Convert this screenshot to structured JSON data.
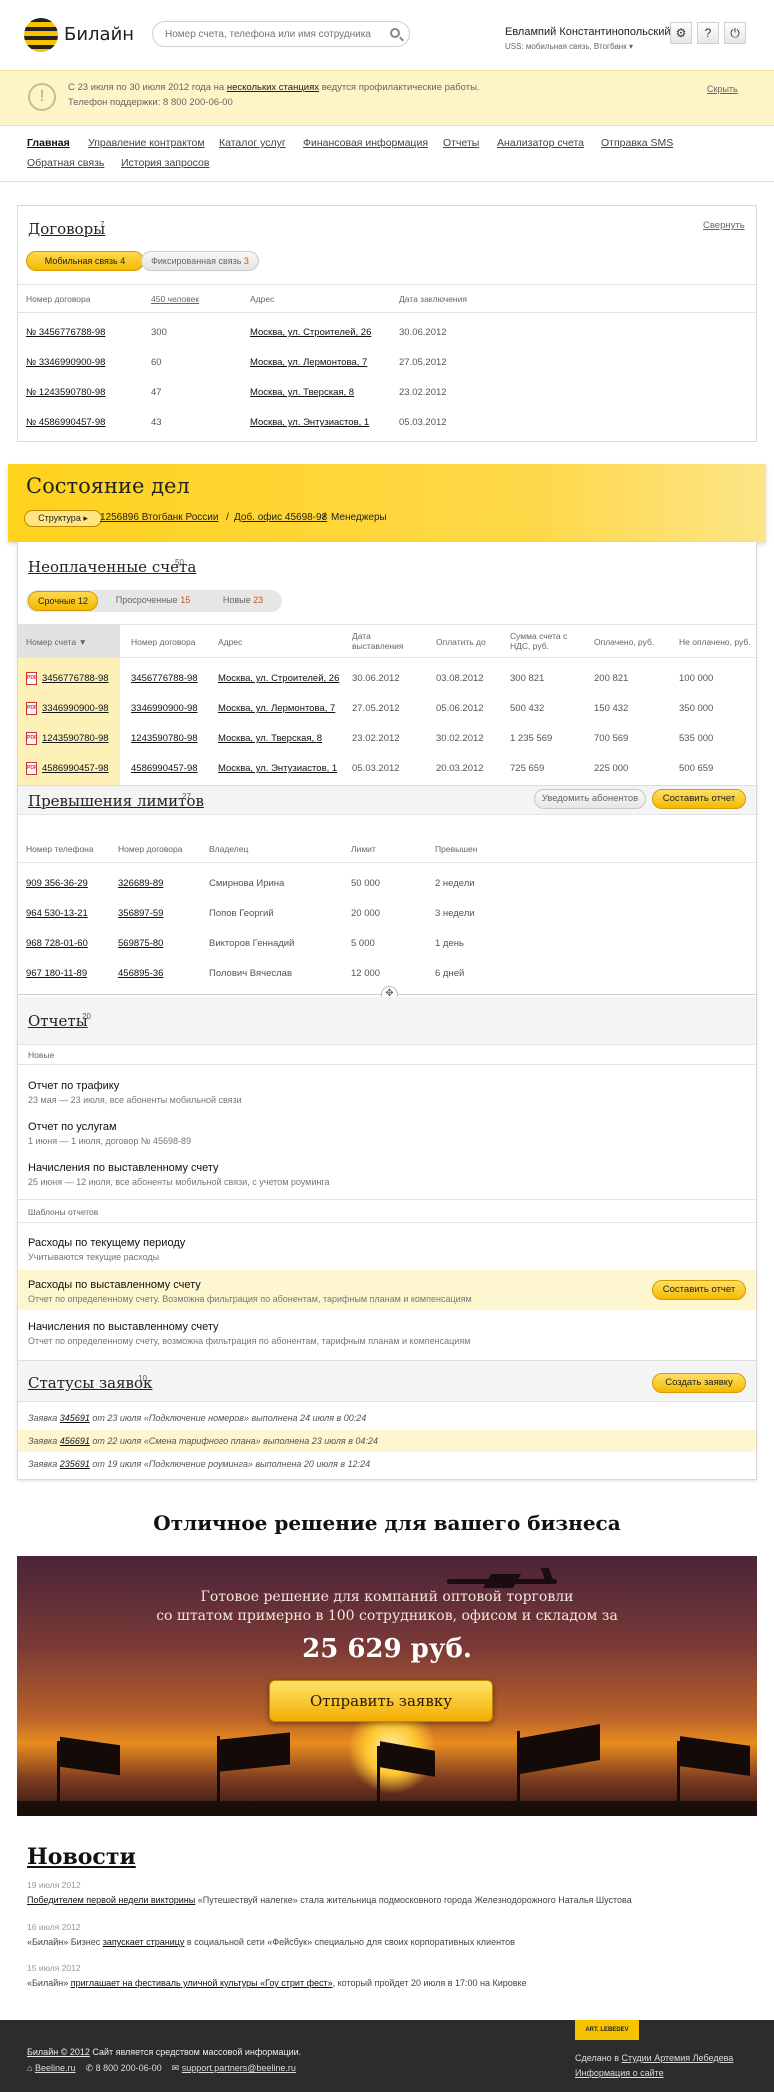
{
  "header": {
    "logo_text": "Билайн",
    "search_placeholder": "Номер счета, телефона или имя сотрудника",
    "user_name": "Евлампий Константинопольский",
    "user_sub": "USS: мобильная связь, Втогбанк",
    "btn_settings": "⚙",
    "btn_help": "?",
    "btn_exit": "⏻"
  },
  "notice": {
    "icon": "!",
    "text_pre": "С 23 июля по 30 июля 2012 года на ",
    "link": "нескольких станциях",
    "text_post": " ведутся профилактические работы.",
    "phone": "Телефон поддержки: 8 800 200-06-00",
    "hide": "Скрыть"
  },
  "nav": [
    "Главная",
    "Управление контрактом",
    "Каталог услуг",
    "Финансовая информация",
    "Отчеты",
    "Анализатор счета",
    "Отправка SMS",
    "Обратная связь",
    "История запросов"
  ],
  "contracts": {
    "title": "Договоры",
    "count": "7",
    "collapse": "Свернуть",
    "tab1": "Мобильная связь",
    "tab1_n": "4",
    "tab2": "Фиксированная связь",
    "tab2_n": "3",
    "headers": [
      "Номер договора",
      "450 человек",
      "Адрес",
      "Дата заключения"
    ],
    "rows": [
      [
        "№ 3456776788-98",
        "300",
        "Москва, ул. Строителей, 26",
        "30.06.2012"
      ],
      [
        "№ 3346990900-98",
        "60",
        "Москва, ул. Лермонтова, 7",
        "27.05.2012"
      ],
      [
        "№ 1243590780-98",
        "47",
        "Москва, ул. Тверская, 8",
        "23.02.2012"
      ],
      [
        "№ 4586990457-98",
        "43",
        "Москва, ул. Энтузиастов, 1",
        "05.03.2012"
      ]
    ]
  },
  "state": {
    "title": "Состояние дел",
    "crumb_btn": "Структура",
    "crumb_1": "1256896 Втогбанк России",
    "crumb_2": "Доб. офис 45698-98",
    "crumb_3": "Менеджеры",
    "sep": "/"
  },
  "unpaid": {
    "title": "Неоплаченные счета",
    "count": "50",
    "tab1": "Срочные",
    "tab1_n": "12",
    "tab2": "Просроченные",
    "tab2_n": "15",
    "tab3": "Новые",
    "tab3_n": "23",
    "headers": [
      "Номер счета",
      "Номер договора",
      "Адрес",
      "Дата выставления",
      "Оплатить до",
      "Сумма счета с НДС, руб.",
      "Оплачено, руб.",
      "Не оплачено, руб."
    ],
    "rows": [
      [
        "3456776788-98",
        "3456776788-98",
        "Москва, ул. Строителей, 26",
        "30.06.2012",
        "03.08.2012",
        "300 821",
        "200 821",
        "100 000"
      ],
      [
        "3346990900-98",
        "3346990900-98",
        "Москва, ул. Лермонтова, 7",
        "27.05.2012",
        "05.06.2012",
        "500 432",
        "150 432",
        "350 000"
      ],
      [
        "1243590780-98",
        "1243590780-98",
        "Москва, ул. Тверская, 8",
        "23.02.2012",
        "30.02.2012",
        "1 235 569",
        "700 569",
        "535 000"
      ],
      [
        "4586990457-98",
        "4586990457-98",
        "Москва, ул. Энтузиастов, 1",
        "05.03.2012",
        "20.03.2012",
        "725 659",
        "225 000",
        "500 659"
      ]
    ],
    "pdf": "PDF"
  },
  "limits": {
    "title": "Превышения лимитов",
    "count": "27",
    "btn_notify": "Уведомить абонентов",
    "btn_report": "Составить отчет",
    "headers": [
      "Номер телефона",
      "Номер договора",
      "Владелец",
      "Лимит",
      "Превышен"
    ],
    "rows": [
      [
        "909 356-36-29",
        "326689-89",
        "Смирнова Ирина",
        "50 000",
        "2 недели"
      ],
      [
        "964 530-13-21",
        "356897-59",
        "Попов Георгий",
        "20 000",
        "3 недели"
      ],
      [
        "968 728-01-60",
        "569875-80",
        "Викторов Геннадий",
        "5 000",
        "1 день"
      ],
      [
        "967 180-11-89",
        "456895-36",
        "Полович Вячеслав",
        "12 000",
        "6 дней"
      ]
    ]
  },
  "reports": {
    "title": "Отчеты",
    "count": "20",
    "new_label": "Новые",
    "new_items": [
      [
        "Отчет по трафику",
        "23 мая — 23 июля, все абоненты мобильной связи"
      ],
      [
        "Отчет по услугам",
        "1 июня — 1 июля, договор № 45698-89"
      ],
      [
        "Начисления по выставленному счету",
        "25 июня — 12 июля, все абоненты мобильной связи, с учетом роуминга"
      ]
    ],
    "tpl_label": "Шаблоны отчетов",
    "tpl_items": [
      [
        "Расходы по текущему периоду",
        "Учитываются текущие расходы"
      ],
      [
        "Расходы по выставленному счету",
        "Отчет по определенному счету. Возможна фильтрация по абонентам, тарифным планам и компенсациям"
      ],
      [
        "Начисления по выставленному счету",
        "Отчет по определенному счету, возможна фильтрация по абонентам, тарифным планам и компенсациям"
      ]
    ],
    "tpl_btn": "Составить отчет"
  },
  "requests": {
    "title": "Статусы заявок",
    "count": "10",
    "btn": "Создать заявку",
    "rows": [
      [
        "Заявка ",
        "345691",
        " от 23 июля «Подключение номеров» выполнена 24 июля в 00:24"
      ],
      [
        "Заявка ",
        "456691",
        " от 22 июля «Смена тарифного плана» выполнена 23 июля в 04:24"
      ],
      [
        "Заявка ",
        "235691",
        " от 19 июля «Подключение роуминга» выполнена 20 июля в 12:24"
      ]
    ]
  },
  "promo": {
    "title": "Отличное решение для вашего бизнеса",
    "line1": "Готовое решение для компаний оптовой торговли",
    "line2": "со штатом примерно в 100 сотрудников, офисом и складом за",
    "price": "25 629 руб.",
    "btn": "Отправить заявку"
  },
  "news": {
    "title": "Новости",
    "items": [
      [
        "19 июля 2012",
        "Победителем первой недели викторины",
        " «Путешествуй налегке» стала жительница подмосковного города Железнодорожного Наталья Шустова"
      ],
      [
        "16 июля 2012",
        "«Билайн» Бизнес ",
        "запускает страницу",
        " в социальной сети «Фейсбук» специально для своих корпоративных клиентов"
      ],
      [
        "15 июля 2012",
        "«Билайн» ",
        "приглашает на фестиваль уличной культуры «Гоу стрит фест»",
        ", который пройдет 20 июля в 17:00 на Кировке"
      ]
    ]
  },
  "footer": {
    "copy": "Билайн © 2012",
    "copy_note": " Сайт является средством массовой информации.",
    "site": "Beeline.ru",
    "phone": "8 800 200-06-00",
    "email": "support.partners@beeline.ru",
    "studio_pre": "Сделано в ",
    "studio": "Студии Артемия Лебедева",
    "about": "Информация о сайте",
    "logo_text": "ART. LEBEDEV"
  }
}
